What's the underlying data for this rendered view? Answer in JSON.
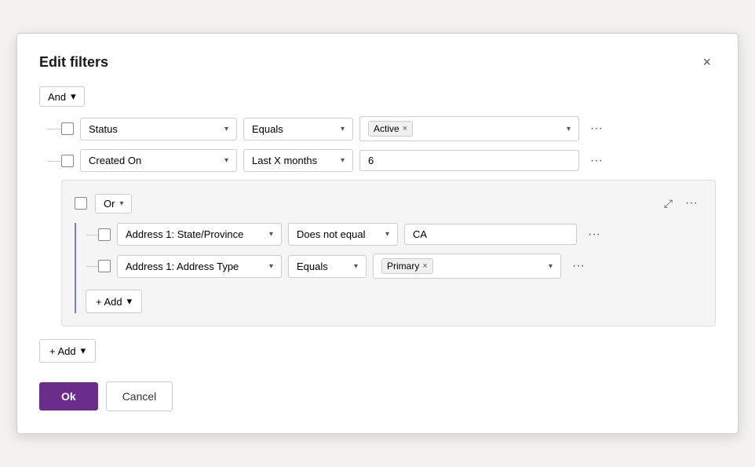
{
  "dialog": {
    "title": "Edit filters",
    "close_label": "×"
  },
  "and_operator": {
    "label": "And",
    "chevron": "▾"
  },
  "rows": [
    {
      "field": "Status",
      "operator": "Equals",
      "value_tag": "Active",
      "value_type": "tag"
    },
    {
      "field": "Created On",
      "operator": "Last X months",
      "value": "6",
      "value_type": "text"
    }
  ],
  "or_group": {
    "operator": "Or",
    "chevron": "▾",
    "collapse_icon": "⤢",
    "more_icon": "···",
    "rows": [
      {
        "field": "Address 1: State/Province",
        "operator": "Does not equal",
        "value": "CA",
        "value_type": "text"
      },
      {
        "field": "Address 1: Address Type",
        "operator": "Equals",
        "value_tag": "Primary",
        "value_type": "tag"
      }
    ],
    "add_label": "+ Add",
    "add_chevron": "▾"
  },
  "main_add": {
    "label": "+ Add",
    "chevron": "▾"
  },
  "footer": {
    "ok_label": "Ok",
    "cancel_label": "Cancel"
  }
}
